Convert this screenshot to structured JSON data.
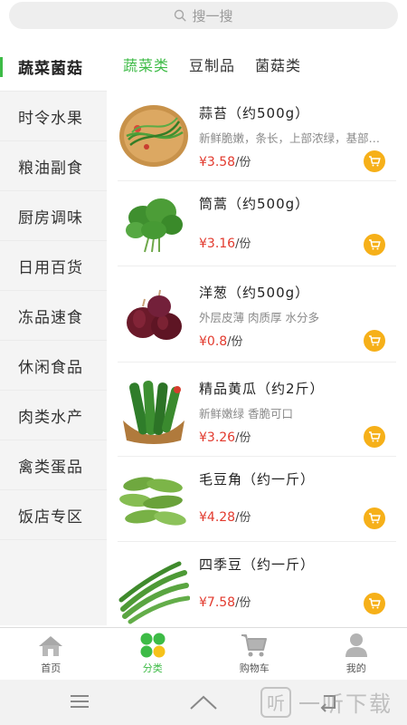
{
  "search": {
    "placeholder": "搜一搜"
  },
  "sidebar": {
    "items": [
      {
        "label": "蔬菜菌菇",
        "active": true
      },
      {
        "label": "时令水果"
      },
      {
        "label": "粮油副食"
      },
      {
        "label": "厨房调味"
      },
      {
        "label": "日用百货"
      },
      {
        "label": "冻品速食"
      },
      {
        "label": "休闲食品"
      },
      {
        "label": "肉类水产"
      },
      {
        "label": "禽类蛋品"
      },
      {
        "label": "饭店专区"
      }
    ]
  },
  "subtabs": [
    {
      "label": "蔬菜类",
      "active": true
    },
    {
      "label": "豆制品"
    },
    {
      "label": "菌菇类"
    }
  ],
  "products": [
    {
      "name": "蒜苔（约500g）",
      "desc": "新鲜脆嫩，条长，上部浓绿，基部嫩白",
      "price": "¥3.58",
      "unit": "/份",
      "image": "garlic-scape"
    },
    {
      "name": "筒蒿（约500g）",
      "desc": "",
      "price": "¥3.16",
      "unit": "/份",
      "image": "crown-daisy"
    },
    {
      "name": "洋葱（约500g）",
      "desc": "外层皮薄 肉质厚 水分多",
      "price": "¥0.8",
      "unit": "/份",
      "image": "onion"
    },
    {
      "name": "精品黄瓜（约2斤）",
      "desc": "新鲜嫩绿 香脆可口",
      "price": "¥3.26",
      "unit": "/份",
      "image": "cucumber"
    },
    {
      "name": "毛豆角（约一斤）",
      "desc": "",
      "price": "¥4.28",
      "unit": "/份",
      "image": "edamame"
    },
    {
      "name": "四季豆（约一斤）",
      "desc": "",
      "price": "¥7.58",
      "unit": "/份",
      "image": "green-beans"
    }
  ],
  "tabbar": {
    "items": [
      {
        "label": "首页",
        "icon": "home-icon"
      },
      {
        "label": "分类",
        "icon": "category-icon",
        "active": true
      },
      {
        "label": "购物车",
        "icon": "cart-icon"
      },
      {
        "label": "我的",
        "icon": "user-icon"
      }
    ]
  },
  "watermark": {
    "text": "一听下载"
  },
  "colors": {
    "accent": "#3dbb46",
    "price": "#e23a2e",
    "cart_button": "#f6b019"
  }
}
